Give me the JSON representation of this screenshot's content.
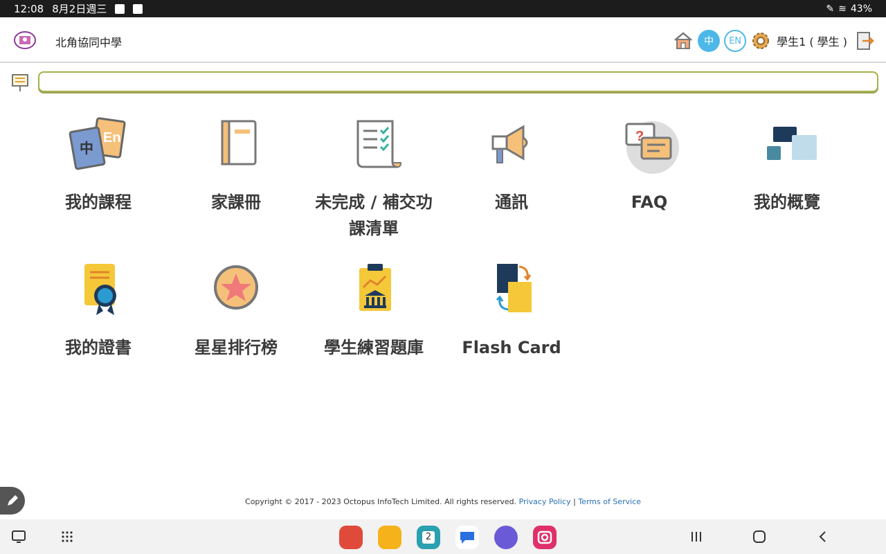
{
  "status_bar": {
    "time": "12:08",
    "date": "8月2日週三",
    "battery": "43%"
  },
  "header": {
    "school_name": "北角協同中學",
    "lang_zh": "中",
    "lang_en": "EN",
    "user": "學生1 ( 學生 )"
  },
  "search": {
    "placeholder": ""
  },
  "tiles": [
    {
      "label": "我的課程",
      "icon": "my-courses-icon"
    },
    {
      "label": "家課冊",
      "icon": "homework-book-icon"
    },
    {
      "label": "未完成 / 補交功課清單",
      "icon": "checklist-icon"
    },
    {
      "label": "通訊",
      "icon": "megaphone-icon"
    },
    {
      "label": "FAQ",
      "icon": "faq-chat-icon"
    },
    {
      "label": "我的概覽",
      "icon": "overview-icon"
    },
    {
      "label": "我的證書",
      "icon": "certificate-icon"
    },
    {
      "label": "星星排行榜",
      "icon": "star-ranking-icon"
    },
    {
      "label": "學生練習題庫",
      "icon": "question-bank-icon"
    },
    {
      "label": "Flash Card",
      "icon": "flash-card-icon"
    }
  ],
  "footer": {
    "copyright": "Copyright © 2017 - 2023 Octopus InfoTech Limited. All rights reserved.",
    "privacy": "Privacy Policy",
    "separator": "|",
    "terms": "Terms of Service"
  },
  "taskbar": {
    "calendar_day": "2"
  },
  "colors": {
    "accent_blue": "#4db8e8",
    "search_border": "#a6b04a"
  }
}
